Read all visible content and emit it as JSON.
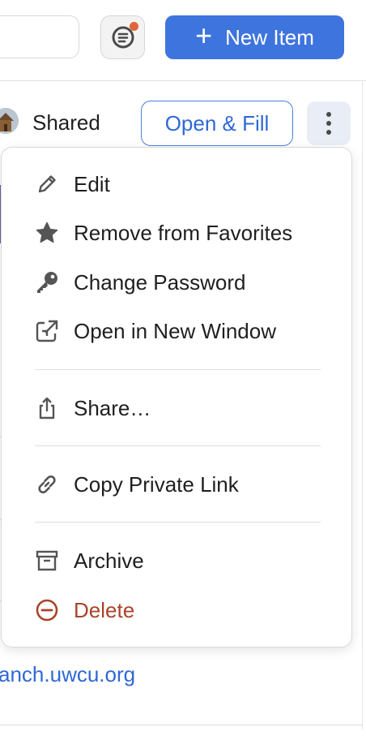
{
  "header": {
    "new_item_label": "New Item",
    "new_item_icon": "plus-icon"
  },
  "item": {
    "vault_label": "Shared",
    "open_fill_label": "Open & Fill"
  },
  "menu": {
    "items": [
      {
        "label": "Edit",
        "icon": "pencil-icon"
      },
      {
        "label": "Remove from Favorites",
        "icon": "star-icon"
      },
      {
        "label": "Change Password",
        "icon": "key-icon"
      },
      {
        "label": "Open in New Window",
        "icon": "open-window-icon"
      },
      {
        "label": "Share…",
        "icon": "share-icon"
      },
      {
        "label": "Copy Private Link",
        "icon": "link-icon"
      },
      {
        "label": "Archive",
        "icon": "archive-icon"
      },
      {
        "label": "Delete",
        "icon": "delete-icon"
      }
    ]
  },
  "background": {
    "link_text": "anch.uwcu.org"
  },
  "colors": {
    "accent": "#3e74dd",
    "danger": "#a9432a",
    "notification": "#e0653a"
  }
}
